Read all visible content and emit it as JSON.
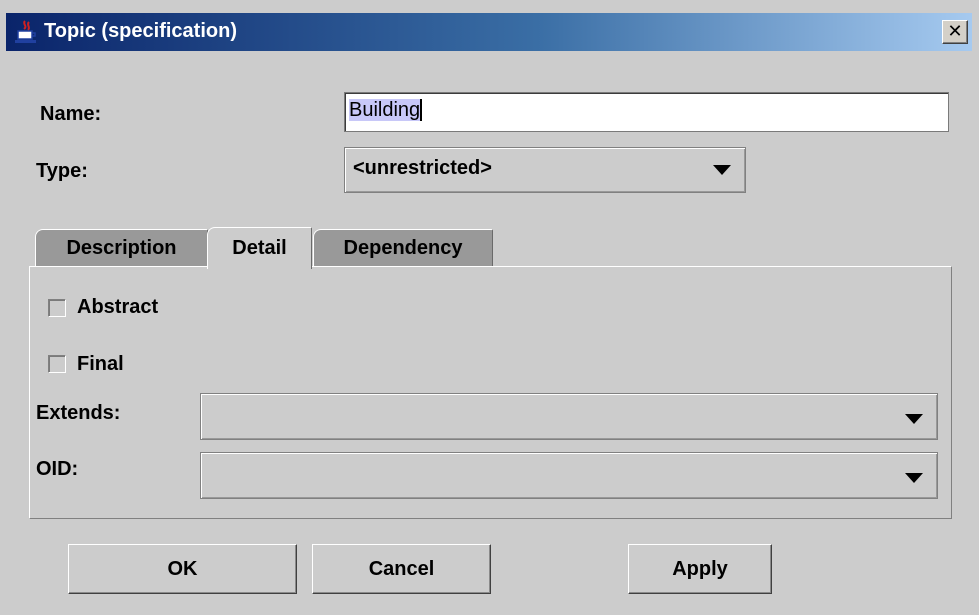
{
  "window": {
    "title": "Topic (specification)",
    "close_glyph": "✕",
    "icon": "java-coffee-icon"
  },
  "form": {
    "name_label": "Name:",
    "name_value": "Building",
    "type_label": "Type:",
    "type_value": "<unrestricted>"
  },
  "tabs": [
    {
      "label": "Description",
      "active": false
    },
    {
      "label": "Detail",
      "active": true
    },
    {
      "label": "Dependency",
      "active": false
    }
  ],
  "detail": {
    "abstract_label": "Abstract",
    "abstract_checked": false,
    "final_label": "Final",
    "final_checked": false,
    "extends_label": "Extends:",
    "extends_value": "",
    "oid_label": "OID:",
    "oid_value": ""
  },
  "buttons": {
    "ok": "OK",
    "cancel": "Cancel",
    "apply": "Apply"
  },
  "colors": {
    "title_gradient_start": "#0a246a",
    "title_gradient_end": "#a6caf0",
    "window_bg": "#cccccc",
    "inactive_tab": "#999999"
  }
}
